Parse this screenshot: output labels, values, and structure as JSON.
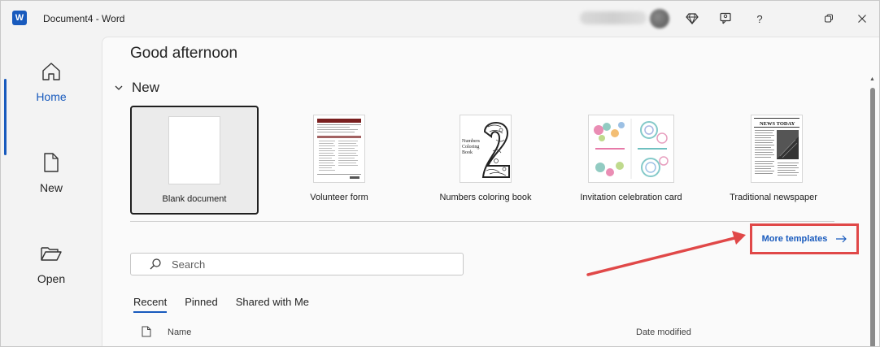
{
  "titlebar": {
    "app_icon_letter": "W",
    "title": "Document4  -  Word",
    "icons": [
      "diamond-icon",
      "coauthor-icon",
      "help-icon",
      "restore-icon",
      "close-icon"
    ],
    "help_label": "?"
  },
  "rail": {
    "items": [
      {
        "label": "Home",
        "icon": "home-icon",
        "active": true
      },
      {
        "label": "New",
        "icon": "new-document-icon",
        "active": false
      },
      {
        "label": "Open",
        "icon": "folder-open-icon",
        "active": false
      }
    ]
  },
  "main": {
    "greeting": "Good afternoon",
    "new_section_label": "New",
    "templates": [
      {
        "label": "Blank document",
        "selected": true
      },
      {
        "label": "Volunteer form",
        "selected": false
      },
      {
        "label": "Numbers coloring book",
        "selected": false,
        "thumb_text": "Numbers Coloring Book"
      },
      {
        "label": "Invitation celebration card",
        "selected": false
      },
      {
        "label": "Traditional newspaper",
        "selected": false,
        "thumb_text": "NEWS TODAY"
      }
    ],
    "more_templates_label": "More templates",
    "search_placeholder": "Search",
    "tabs": [
      {
        "label": "Recent",
        "active": true
      },
      {
        "label": "Pinned",
        "active": false
      },
      {
        "label": "Shared with Me",
        "active": false
      }
    ],
    "columns": {
      "name": "Name",
      "date_modified": "Date modified"
    }
  },
  "colors": {
    "accent": "#185abd",
    "highlight": "#e04848"
  }
}
